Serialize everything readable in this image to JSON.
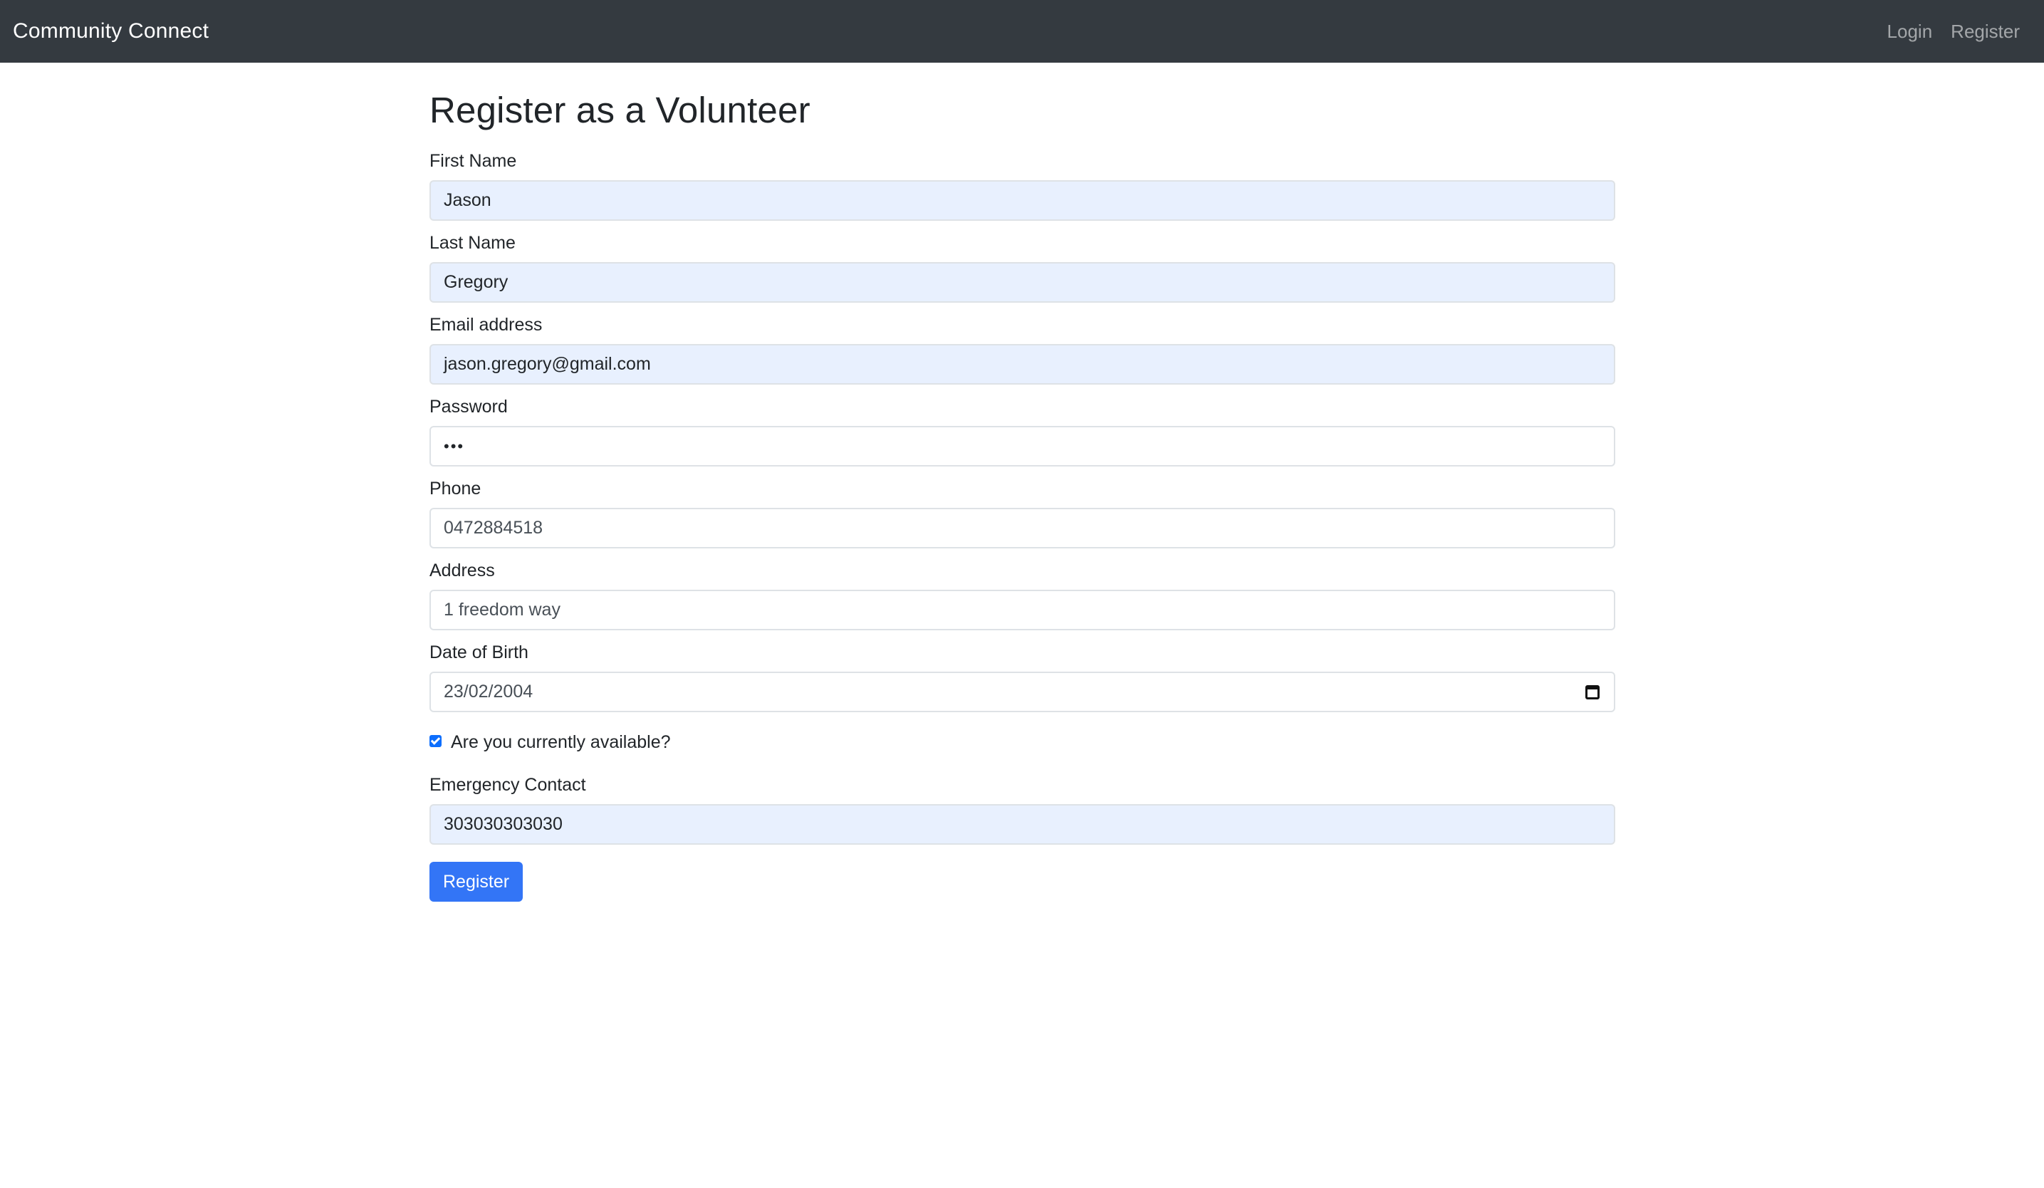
{
  "navbar": {
    "brand": "Community Connect",
    "links": [
      {
        "label": "Login"
      },
      {
        "label": "Register"
      }
    ]
  },
  "page": {
    "title": "Register as a Volunteer"
  },
  "form": {
    "first_name": {
      "label": "First Name",
      "value": "Jason"
    },
    "last_name": {
      "label": "Last Name",
      "value": "Gregory"
    },
    "email": {
      "label": "Email address",
      "value": "jason.gregory@gmail.com"
    },
    "password": {
      "label": "Password",
      "value": "•••"
    },
    "phone": {
      "label": "Phone",
      "value": "0472884518"
    },
    "address": {
      "label": "Address",
      "value": "1 freedom way"
    },
    "dob": {
      "label": "Date of Birth",
      "value": "23/02/2004"
    },
    "available": {
      "label": "Are you currently available?",
      "checked": true
    },
    "emergency_contact": {
      "label": "Emergency Contact",
      "value": "303030303030"
    },
    "submit_label": "Register"
  },
  "colors": {
    "navbar_bg": "#343a40",
    "primary": "#0d6efd",
    "autofill_bg": "#e8f0fe"
  }
}
